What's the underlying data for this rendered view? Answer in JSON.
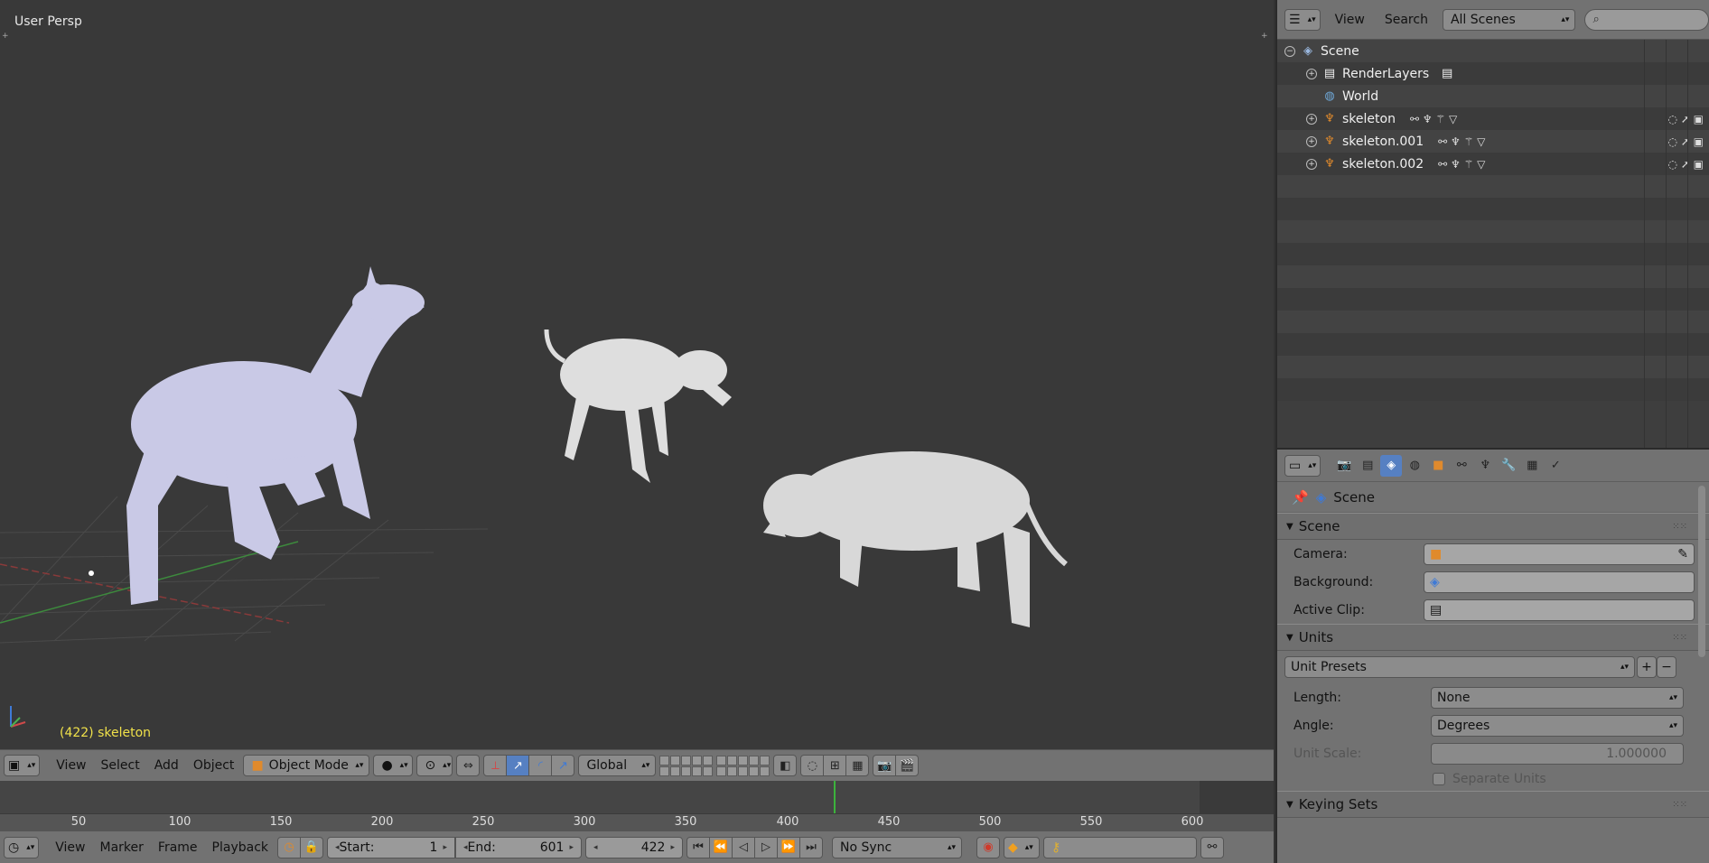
{
  "viewport": {
    "title": "User Persp",
    "object_label": "(422) skeleton",
    "axis_z": "z",
    "header": {
      "menus": [
        "View",
        "Select",
        "Add",
        "Object"
      ],
      "mode": "Object Mode",
      "orientation": "Global"
    }
  },
  "timeline": {
    "ticks": [
      "50",
      "100",
      "150",
      "200",
      "250",
      "300",
      "350",
      "400",
      "450",
      "500",
      "550",
      "600"
    ],
    "current_frame": 422,
    "header": {
      "menus": [
        "View",
        "Marker",
        "Frame",
        "Playback"
      ],
      "start_label": "Start:",
      "start_value": "1",
      "end_label": "End:",
      "end_value": "601",
      "current": "422",
      "sync": "No Sync"
    }
  },
  "outliner": {
    "menus": [
      "View",
      "Search"
    ],
    "scene_filter": "All Scenes",
    "rows": [
      {
        "label": "Scene",
        "indent": 0,
        "icon": "scene-icon"
      },
      {
        "label": "RenderLayers",
        "indent": 1,
        "icon": "render-layers-icon"
      },
      {
        "label": "World",
        "indent": 1,
        "icon": "world-icon"
      },
      {
        "label": "skeleton",
        "indent": 1,
        "icon": "armature-icon"
      },
      {
        "label": "skeleton.001",
        "indent": 1,
        "icon": "armature-icon"
      },
      {
        "label": "skeleton.002",
        "indent": 1,
        "icon": "armature-icon"
      }
    ]
  },
  "properties": {
    "context": "Scene",
    "scene_panel": {
      "title": "Scene",
      "camera_label": "Camera:",
      "background_label": "Background:",
      "active_clip_label": "Active Clip:"
    },
    "units_panel": {
      "title": "Units",
      "presets": "Unit Presets",
      "length_label": "Length:",
      "length_value": "None",
      "angle_label": "Angle:",
      "angle_value": "Degrees",
      "unit_scale_label": "Unit Scale:",
      "unit_scale_value": "1.000000",
      "separate_units": "Separate Units"
    },
    "keying_sets_title": "Keying Sets"
  },
  "colors": {
    "accent": "#5680c2",
    "frame_line": "#3cb23c",
    "object_label": "#f0e14a"
  }
}
